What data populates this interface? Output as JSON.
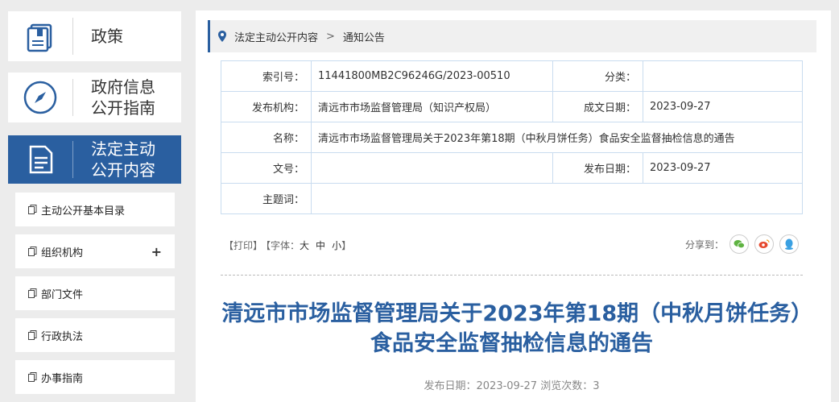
{
  "sidebar": {
    "cards": [
      {
        "label": "政策",
        "icon": "book-icon"
      },
      {
        "label": "政府信息\n公开指南",
        "icon": "compass-icon"
      },
      {
        "label": "法定主动\n公开内容",
        "icon": "document-icon"
      }
    ],
    "items": [
      {
        "label": "主动公开基本目录"
      },
      {
        "label": "组织机构",
        "expand": "+"
      },
      {
        "label": "部门文件"
      },
      {
        "label": "行政执法"
      },
      {
        "label": "办事指南"
      }
    ]
  },
  "breadcrumb": {
    "level1": "法定主动公开内容",
    "separator": ">",
    "level2": "通知公告"
  },
  "meta": {
    "index_label": "索引号：",
    "index_value": "11441800MB2C96246G/2023-00510",
    "category_label": "分类：",
    "category_value": "",
    "publisher_label": "发布机构：",
    "publisher_value": "清远市市场监督管理局（知识产权局）",
    "created_label": "成文日期：",
    "created_value": "2023-09-27",
    "name_label": "名称：",
    "name_value": "清远市市场监督管理局关于2023年第18期（中秋月饼任务）食品安全监督抽检信息的通告",
    "docno_label": "文号：",
    "docno_value": "",
    "pubdate_label": "发布日期：",
    "pubdate_value": "2023-09-27",
    "subject_label": "主题词：",
    "subject_value": ""
  },
  "tools": {
    "print": "【打印】",
    "font_label": "【字体：",
    "font_large": "大",
    "font_medium": "中",
    "font_small": "小",
    "font_end": "】"
  },
  "share": {
    "label": "分享到：",
    "wechat_color": "#5fb342",
    "weibo_color": "#e6492d",
    "qq_color": "#3aa0e2"
  },
  "article": {
    "title": "清远市市场监督管理局关于2023年第18期（中秋月饼任务）食品安全监督抽检信息的通告",
    "pub_info": "发布日期：2023-09-27  浏览次数：3"
  },
  "colors": {
    "accent": "#2a5fa0"
  }
}
